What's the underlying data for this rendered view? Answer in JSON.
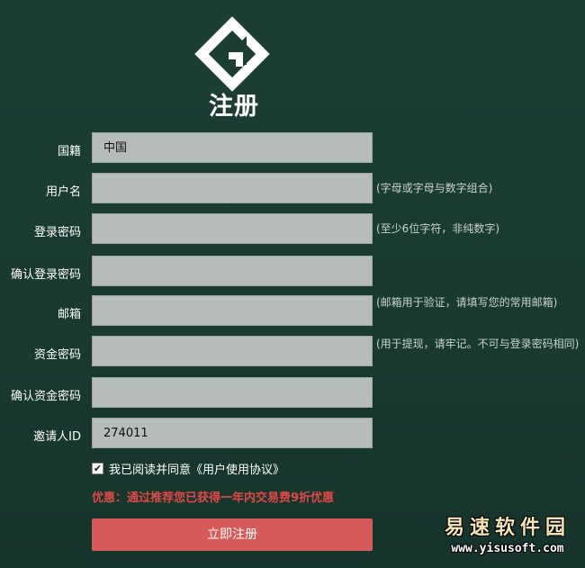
{
  "header": {
    "logo_icon": "g-diamond-logo-icon",
    "title": "注册"
  },
  "form": {
    "country": {
      "label": "国籍",
      "value": "中国"
    },
    "username": {
      "label": "用户名",
      "value": "",
      "hint": "(字母或字母与数字组合)"
    },
    "login_password": {
      "label": "登录密码",
      "value": "",
      "hint": "(至少6位字符，非纯数字)"
    },
    "confirm_login_password": {
      "label": "确认登录密码",
      "value": ""
    },
    "email": {
      "label": "邮箱",
      "value": "",
      "hint": "(邮箱用于验证，请填写您的常用邮箱)"
    },
    "fund_password": {
      "label": "资金密码",
      "value": "",
      "hint": "(用于提现，请牢记。不可与登录密码相同)"
    },
    "confirm_fund_password": {
      "label": "确认资金密码",
      "value": ""
    },
    "inviter_id": {
      "label": "邀请人ID",
      "value": "274011"
    },
    "agreement": {
      "checked": true,
      "check_mark": "✔",
      "text": "我已阅读并同意《用户使用协议》"
    },
    "promo_text": "优惠：通过推荐您已获得一年内交易费9折优惠",
    "submit_label": "立即注册"
  },
  "watermark": {
    "name": "易速软件园",
    "url": "www.yisusoft.com"
  },
  "colors": {
    "background": "#1b3c31",
    "field": "#b6bcb9",
    "promo": "#e04848",
    "submit": "#d75a5a"
  }
}
